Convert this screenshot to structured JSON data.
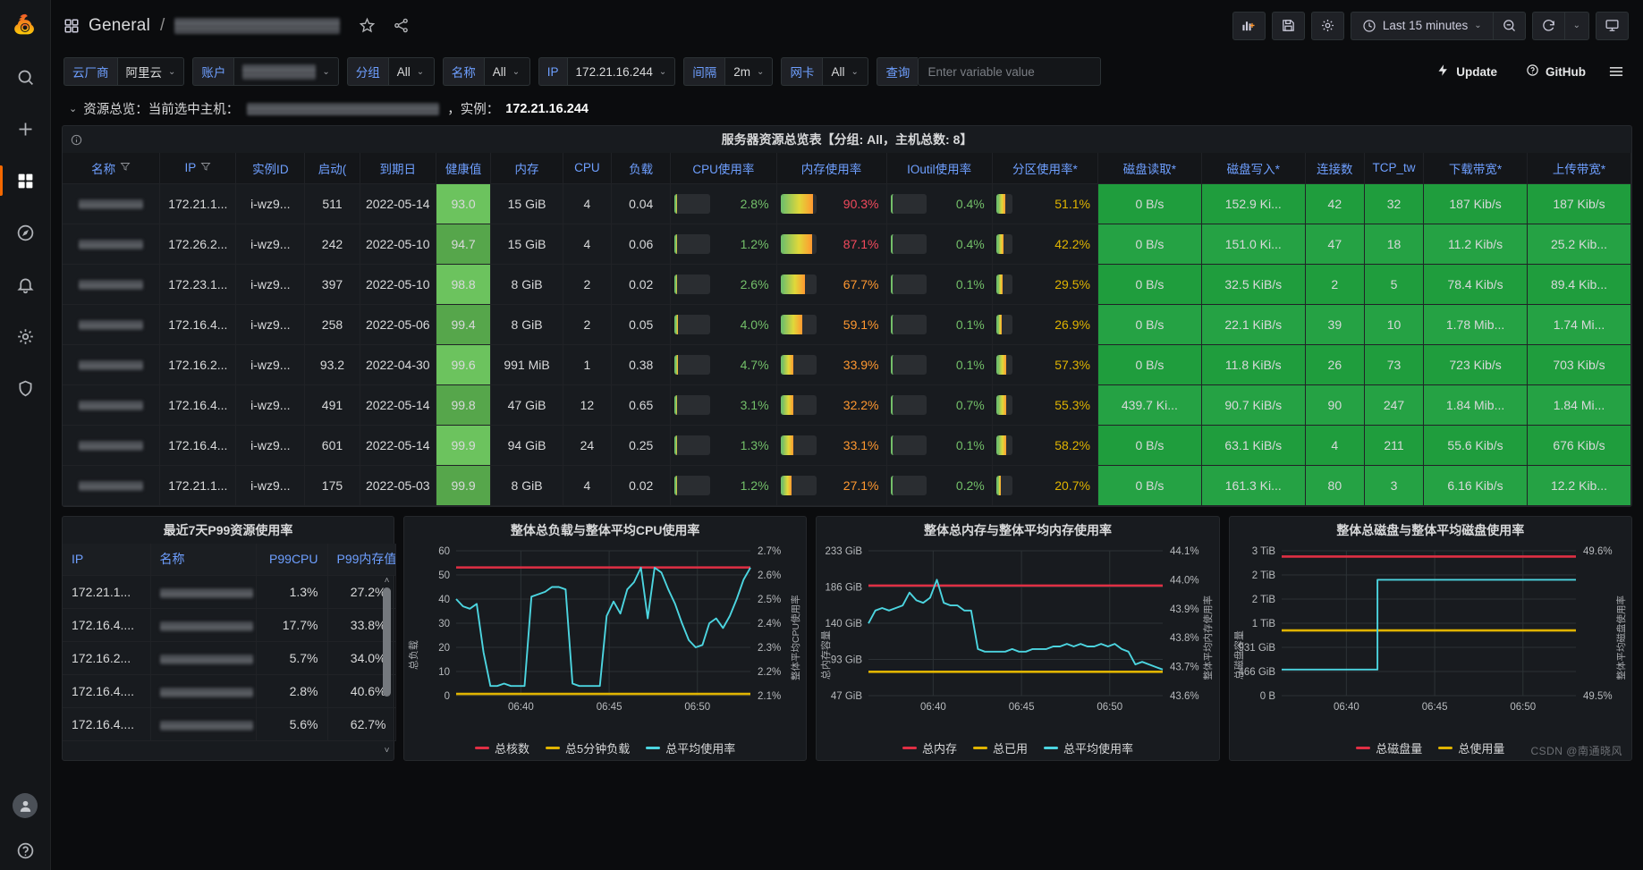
{
  "nav": {
    "logo": "grafana-logo",
    "items": [
      {
        "name": "search-icon",
        "label": "Search"
      },
      {
        "name": "plus-icon",
        "label": "Create"
      },
      {
        "name": "dashboards-icon",
        "label": "Dashboards"
      },
      {
        "name": "compass-icon",
        "label": "Explore"
      },
      {
        "name": "bell-icon",
        "label": "Alerting"
      },
      {
        "name": "gear-icon",
        "label": "Configuration"
      },
      {
        "name": "shield-icon",
        "label": "Server Admin"
      },
      {
        "name": "help-icon",
        "label": "Help"
      }
    ]
  },
  "header": {
    "folder": "General",
    "separator": "/",
    "dashboard_title_redacted": true,
    "star_icon": "star-icon",
    "share_icon": "share-icon",
    "actions": {
      "add_panel": "add-panel-icon",
      "save": "save-icon",
      "settings": "gear-icon",
      "time_range": "Last 15 minutes",
      "zoom_out": "zoom-out-icon",
      "refresh": "refresh-icon",
      "refresh_interval_caret": "chevron-down-icon",
      "kiosk": "tv-icon"
    }
  },
  "variables": [
    {
      "label": "云厂商",
      "value": "阿里云",
      "type": "select"
    },
    {
      "label": "账户",
      "value": "",
      "redacted": true,
      "type": "select"
    },
    {
      "label": "分组",
      "value": "All",
      "type": "select"
    },
    {
      "label": "名称",
      "value": "All",
      "type": "select"
    },
    {
      "label": "IP",
      "value": "172.21.16.244",
      "type": "select"
    },
    {
      "label": "间隔",
      "value": "2m",
      "type": "select"
    },
    {
      "label": "网卡",
      "value": "All",
      "type": "select"
    },
    {
      "label": "查询",
      "value": "",
      "placeholder": "Enter variable value",
      "type": "textbox"
    }
  ],
  "var_right": {
    "update_label": "Update",
    "update_icon": "bolt-icon",
    "github_label": "GitHub",
    "github_icon": "question-circle-icon",
    "menu_icon": "hamburger-icon"
  },
  "row": {
    "chevron": "chevron-down-icon",
    "prefix": "资源总览：当前选中主机：",
    "host_redacted": true,
    "middle": "，实例：",
    "instance": "172.21.16.244"
  },
  "main_panel": {
    "title": "服务器资源总览表【分组: All，主机总数: 8】",
    "info_icon": "info-icon",
    "columns": [
      {
        "label": "名称",
        "filter": true
      },
      {
        "label": "IP",
        "filter": true
      },
      {
        "label": "实例ID",
        "filter": false
      },
      {
        "label": "启动(",
        "filter": false
      },
      {
        "label": "到期日",
        "filter": false
      },
      {
        "label": "健康值",
        "filter": false
      },
      {
        "label": "内存",
        "filter": false
      },
      {
        "label": "CPU",
        "filter": false
      },
      {
        "label": "负载",
        "filter": false
      },
      {
        "label": "CPU使用率",
        "filter": false
      },
      {
        "label": "内存使用率",
        "filter": false
      },
      {
        "label": "IOutil使用率",
        "filter": false
      },
      {
        "label": "分区使用率*",
        "filter": false
      },
      {
        "label": "磁盘读取*",
        "filter": false
      },
      {
        "label": "磁盘写入*",
        "filter": false
      },
      {
        "label": "连接数",
        "filter": false
      },
      {
        "label": "TCP_tw",
        "filter": false
      },
      {
        "label": "下载带宽*",
        "filter": false
      },
      {
        "label": "上传带宽*",
        "filter": false
      }
    ],
    "rows": [
      {
        "name": "",
        "ip": "172.21.1...",
        "instance_id": "i-wz9...",
        "uptime": "511",
        "expire": "2022-05-14",
        "health": "93.0",
        "mem": "15 GiB",
        "cpu": "4",
        "load": "0.04",
        "cpu_pct": {
          "text": "2.8%",
          "fill": 3,
          "color": "#73bf69"
        },
        "mem_pct": {
          "text": "90.3%",
          "fill": 90,
          "color": "#f2495c"
        },
        "io_pct": {
          "text": "0.4%",
          "fill": 1,
          "color": "#73bf69"
        },
        "part_pct": {
          "text": "51.1%",
          "fill": 51,
          "color": "#e0b400"
        },
        "disk_read": "0 B/s",
        "disk_write": "152.9 Ki...",
        "conn": "42",
        "tcp_tw": "32",
        "down": "187 Kib/s",
        "up": "187 Kib/s"
      },
      {
        "name": "",
        "ip": "172.26.2...",
        "instance_id": "i-wz9...",
        "uptime": "242",
        "expire": "2022-05-10",
        "health": "94.7",
        "mem": "15 GiB",
        "cpu": "4",
        "load": "0.06",
        "cpu_pct": {
          "text": "1.2%",
          "fill": 2,
          "color": "#73bf69"
        },
        "mem_pct": {
          "text": "87.1%",
          "fill": 87,
          "color": "#f2495c"
        },
        "io_pct": {
          "text": "0.4%",
          "fill": 1,
          "color": "#73bf69"
        },
        "part_pct": {
          "text": "42.2%",
          "fill": 42,
          "color": "#e0b400"
        },
        "disk_read": "0 B/s",
        "disk_write": "151.0 Ki...",
        "conn": "47",
        "tcp_tw": "18",
        "down": "11.2 Kib/s",
        "up": "25.2 Kib..."
      },
      {
        "name": "",
        "ip": "172.23.1...",
        "instance_id": "i-wz9...",
        "uptime": "397",
        "expire": "2022-05-10",
        "health": "98.8",
        "mem": "8 GiB",
        "cpu": "2",
        "load": "0.02",
        "cpu_pct": {
          "text": "2.6%",
          "fill": 3,
          "color": "#73bf69"
        },
        "mem_pct": {
          "text": "67.7%",
          "fill": 68,
          "color": "#ff9830"
        },
        "io_pct": {
          "text": "0.1%",
          "fill": 1,
          "color": "#73bf69"
        },
        "part_pct": {
          "text": "29.5%",
          "fill": 30,
          "color": "#e0b400"
        },
        "disk_read": "0 B/s",
        "disk_write": "32.5 KiB/s",
        "conn": "2",
        "tcp_tw": "5",
        "down": "78.4 Kib/s",
        "up": "89.4 Kib..."
      },
      {
        "name": "",
        "ip": "172.16.4...",
        "instance_id": "i-wz9...",
        "uptime": "258",
        "expire": "2022-05-06",
        "health": "99.4",
        "mem": "8 GiB",
        "cpu": "2",
        "load": "0.05",
        "cpu_pct": {
          "text": "4.0%",
          "fill": 4,
          "color": "#73bf69"
        },
        "mem_pct": {
          "text": "59.1%",
          "fill": 59,
          "color": "#ff9830"
        },
        "io_pct": {
          "text": "0.1%",
          "fill": 1,
          "color": "#73bf69"
        },
        "part_pct": {
          "text": "26.9%",
          "fill": 27,
          "color": "#e0b400"
        },
        "disk_read": "0 B/s",
        "disk_write": "22.1 KiB/s",
        "conn": "39",
        "tcp_tw": "10",
        "down": "1.78 Mib...",
        "up": "1.74 Mi..."
      },
      {
        "name": "",
        "ip": "172.16.2...",
        "instance_id": "i-wz9...",
        "uptime": "93.2",
        "expire": "2022-04-30",
        "health": "99.6",
        "mem": "991 MiB",
        "cpu": "1",
        "load": "0.38",
        "cpu_pct": {
          "text": "4.7%",
          "fill": 5,
          "color": "#73bf69"
        },
        "mem_pct": {
          "text": "33.9%",
          "fill": 34,
          "color": "#ff9830"
        },
        "io_pct": {
          "text": "0.1%",
          "fill": 1,
          "color": "#73bf69"
        },
        "part_pct": {
          "text": "57.3%",
          "fill": 57,
          "color": "#e0b400"
        },
        "disk_read": "0 B/s",
        "disk_write": "11.8 KiB/s",
        "conn": "26",
        "tcp_tw": "73",
        "down": "723 Kib/s",
        "up": "703 Kib/s"
      },
      {
        "name": "",
        "ip": "172.16.4...",
        "instance_id": "i-wz9...",
        "uptime": "491",
        "expire": "2022-05-14",
        "health": "99.8",
        "mem": "47 GiB",
        "cpu": "12",
        "load": "0.65",
        "cpu_pct": {
          "text": "3.1%",
          "fill": 3,
          "color": "#73bf69"
        },
        "mem_pct": {
          "text": "32.2%",
          "fill": 32,
          "color": "#ff9830"
        },
        "io_pct": {
          "text": "0.7%",
          "fill": 1,
          "color": "#73bf69"
        },
        "part_pct": {
          "text": "55.3%",
          "fill": 55,
          "color": "#e0b400"
        },
        "disk_read": "439.7 Ki...",
        "disk_write": "90.7 KiB/s",
        "conn": "90",
        "tcp_tw": "247",
        "down": "1.84 Mib...",
        "up": "1.84 Mi..."
      },
      {
        "name": "",
        "ip": "172.16.4...",
        "instance_id": "i-wz9...",
        "uptime": "601",
        "expire": "2022-05-14",
        "health": "99.9",
        "mem": "94 GiB",
        "cpu": "24",
        "load": "0.25",
        "cpu_pct": {
          "text": "1.3%",
          "fill": 2,
          "color": "#73bf69"
        },
        "mem_pct": {
          "text": "33.1%",
          "fill": 33,
          "color": "#ff9830"
        },
        "io_pct": {
          "text": "0.1%",
          "fill": 1,
          "color": "#73bf69"
        },
        "part_pct": {
          "text": "58.2%",
          "fill": 58,
          "color": "#e0b400"
        },
        "disk_read": "0 B/s",
        "disk_write": "63.1 KiB/s",
        "conn": "4",
        "tcp_tw": "211",
        "down": "55.6 Kib/s",
        "up": "676 Kib/s"
      },
      {
        "name": "",
        "ip": "172.21.1...",
        "instance_id": "i-wz9...",
        "uptime": "175",
        "expire": "2022-05-03",
        "health": "99.9",
        "mem": "8 GiB",
        "cpu": "4",
        "load": "0.02",
        "cpu_pct": {
          "text": "1.2%",
          "fill": 2,
          "color": "#73bf69"
        },
        "mem_pct": {
          "text": "27.1%",
          "fill": 27,
          "color": "#ff9830"
        },
        "io_pct": {
          "text": "0.2%",
          "fill": 1,
          "color": "#73bf69"
        },
        "part_pct": {
          "text": "20.7%",
          "fill": 21,
          "color": "#e0b400"
        },
        "disk_read": "0 B/s",
        "disk_write": "161.3 Ki...",
        "conn": "80",
        "tcp_tw": "3",
        "down": "6.16 Kib/s",
        "up": "12.2 Kib..."
      }
    ]
  },
  "p99_panel": {
    "title": "最近7天P99资源使用率",
    "columns": [
      "IP",
      "名称",
      "P99CPU",
      "P99内存值"
    ],
    "rows": [
      {
        "ip": "172.21.1...",
        "name": "",
        "cpu": "1.3%",
        "mem": "27.2%"
      },
      {
        "ip": "172.16.4....",
        "name": "",
        "cpu": "17.7%",
        "mem": "33.8%"
      },
      {
        "ip": "172.16.2...",
        "name": "",
        "cpu": "5.7%",
        "mem": "34.0%"
      },
      {
        "ip": "172.16.4....",
        "name": "",
        "cpu": "2.8%",
        "mem": "40.6%"
      },
      {
        "ip": "172.16.4....",
        "name": "",
        "cpu": "5.6%",
        "mem": "62.7%"
      }
    ],
    "scroll_up_icon": "chevron-up-icon",
    "scroll_down_icon": "chevron-down-icon"
  },
  "watermark": "CSDN @南通晓风",
  "chart_data": [
    {
      "type": "line",
      "title": "整体总负载与整体平均CPU使用率",
      "ylabel": "总负载",
      "y2label": "整体平均CPU使用率",
      "xlabel": "",
      "ylim": [
        0,
        60
      ],
      "yticks": [
        "0",
        "10",
        "20",
        "30",
        "40",
        "50",
        "60"
      ],
      "y2lim": [
        2.1,
        2.7
      ],
      "y2ticks": [
        "2.1%",
        "2.2%",
        "2.3%",
        "2.4%",
        "2.5%",
        "2.6%",
        "2.7%"
      ],
      "xticks": [
        "06:40",
        "06:45",
        "06:50"
      ],
      "grid": true,
      "legend_position": "bottom",
      "series": [
        {
          "name": "总核数",
          "color": "#e02f44",
          "kind": "constant",
          "value": 53
        },
        {
          "name": "总5分钟负载",
          "color": "#e0b400",
          "kind": "constant",
          "value": 0.5
        },
        {
          "name": "总平均使用率",
          "color": "#4cd5e0",
          "kind": "line",
          "values": [
            40,
            37,
            36,
            38,
            18,
            4,
            4,
            5,
            4,
            4,
            4,
            41,
            42,
            43,
            45,
            45,
            44,
            5,
            4,
            4,
            4,
            4,
            33,
            39,
            34,
            44,
            47,
            53,
            32,
            53,
            51,
            44,
            38,
            30,
            23,
            20,
            21,
            30,
            32,
            28,
            33,
            40,
            48,
            53
          ]
        }
      ]
    },
    {
      "type": "line",
      "title": "整体总内存与整体平均内存使用率",
      "ylabel": "总内存容量",
      "y2label": "整体平均内存使用率",
      "xlabel": "",
      "ylim_ticks": [
        "47 GiB",
        "93 GiB",
        "140 GiB",
        "186 GiB",
        "233 GiB"
      ],
      "y2lim": [
        43.6,
        44.1
      ],
      "y2ticks": [
        "43.6%",
        "43.7%",
        "43.8%",
        "43.9%",
        "44.0%",
        "44.1%"
      ],
      "xticks": [
        "06:40",
        "06:45",
        "06:50"
      ],
      "grid": true,
      "legend_position": "bottom",
      "series": [
        {
          "name": "总内存",
          "color": "#e02f44",
          "kind": "constant",
          "value": 186
        },
        {
          "name": "总已用",
          "color": "#e0b400",
          "kind": "constant",
          "value": 93
        },
        {
          "name": "总平均使用率",
          "color": "#4cd5e0",
          "kind": "line",
          "values": [
            43.88,
            43.93,
            43.94,
            43.93,
            43.94,
            43.95,
            44.0,
            43.97,
            43.96,
            43.98,
            44.05,
            43.96,
            43.95,
            43.95,
            43.93,
            43.93,
            43.78,
            43.77,
            43.77,
            43.77,
            43.77,
            43.78,
            43.77,
            43.77,
            43.78,
            43.78,
            43.78,
            43.79,
            43.79,
            43.8,
            43.79,
            43.8,
            43.79,
            43.79,
            43.8,
            43.79,
            43.8,
            43.78,
            43.77,
            43.72,
            43.73,
            43.72,
            43.71,
            43.7
          ]
        }
      ]
    },
    {
      "type": "line",
      "title": "整体总磁盘与整体平均磁盘使用率",
      "ylabel": "总磁盘容量",
      "y2label": "整体平均磁盘使用率",
      "xlabel": "",
      "ylim_ticks": [
        "0 B",
        "466 GiB",
        "931 GiB",
        "1 TiB",
        "2 TiB",
        "2 TiB",
        "3 TiB"
      ],
      "y2lim": [
        49.5,
        49.6
      ],
      "y2ticks": [
        "49.5%",
        "49.6%"
      ],
      "xticks": [
        "06:40",
        "06:45",
        "06:50"
      ],
      "grid": true,
      "legend_position": "bottom",
      "series": [
        {
          "name": "总磁盘量",
          "color": "#e02f44",
          "kind": "constant",
          "value": 3
        },
        {
          "name": "总使用量",
          "color": "#e0b400",
          "kind": "constant",
          "value": 1
        },
        {
          "name": "总平均使用率",
          "color": "#4cd5e0",
          "kind": "step",
          "values": [
            49.53,
            49.53,
            49.53,
            49.53,
            49.53,
            49.53,
            49.53,
            49.53,
            49.53,
            49.53,
            49.53,
            49.53,
            49.53,
            49.53,
            49.56,
            49.56,
            49.56,
            49.56,
            49.56,
            49.56,
            49.56,
            49.56,
            49.56,
            49.56,
            49.56,
            49.56,
            49.56,
            49.56,
            49.56,
            49.56,
            49.56,
            49.56,
            49.56,
            49.56,
            49.56,
            49.56,
            49.56,
            49.56,
            49.56,
            49.56,
            49.56,
            49.56,
            49.56,
            49.56
          ]
        }
      ]
    }
  ]
}
